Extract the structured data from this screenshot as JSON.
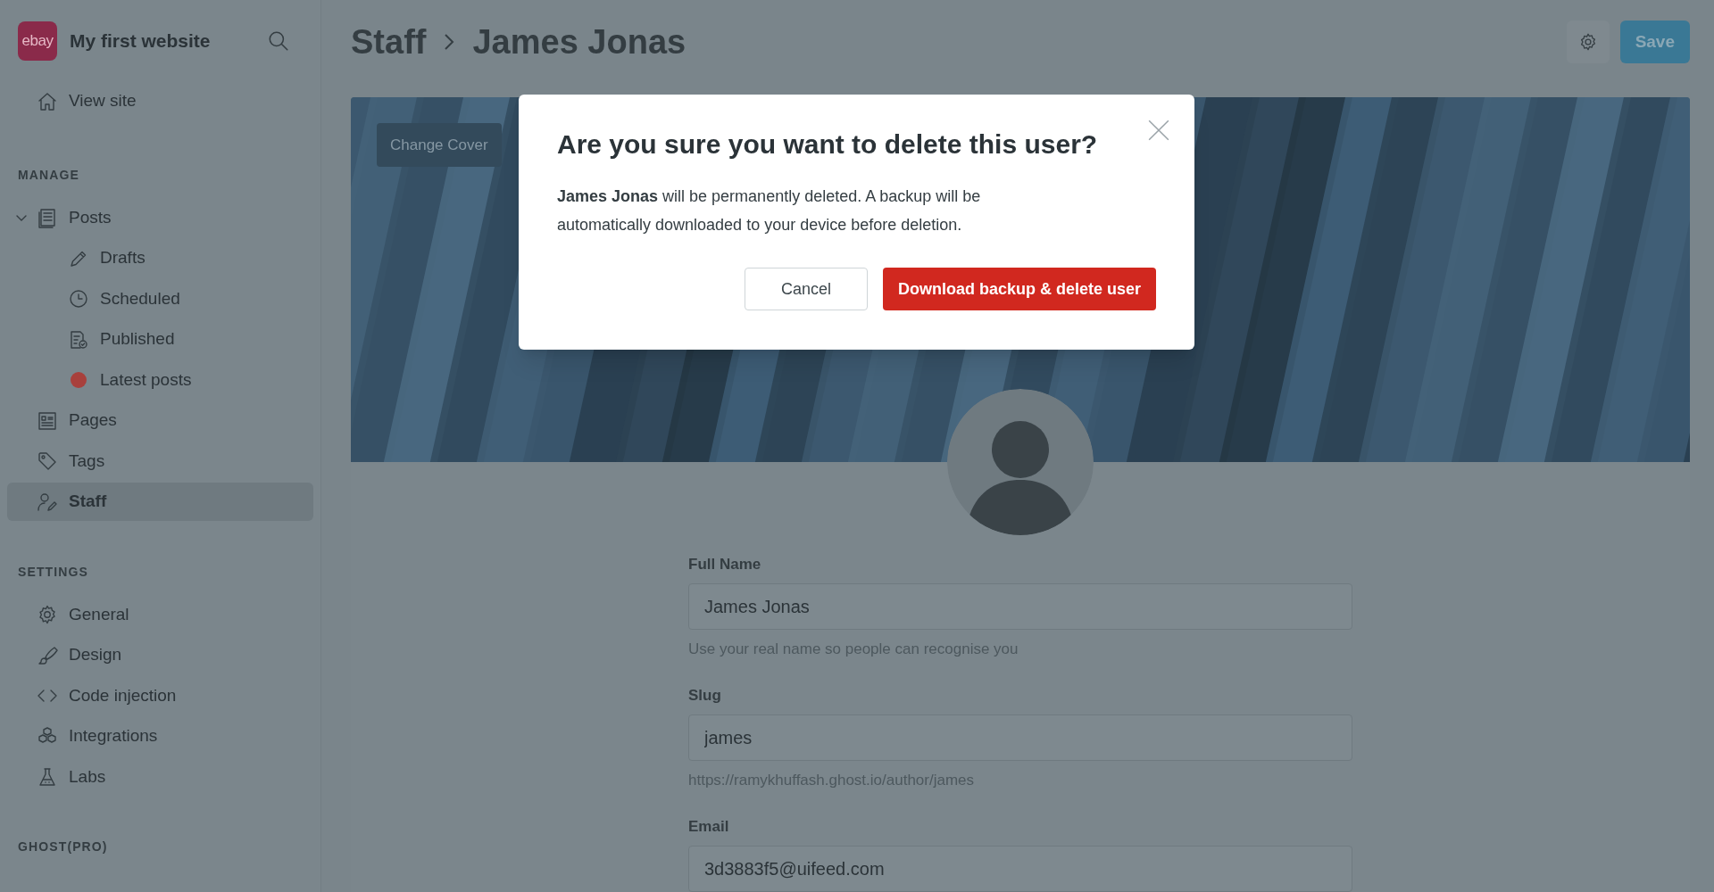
{
  "sidebar": {
    "logo_text": "ebay",
    "site_name": "My first website",
    "top_items": [
      {
        "label": "View site",
        "kind": "home",
        "selected": false
      }
    ],
    "sections": [
      {
        "heading": "MANAGE",
        "items": [
          {
            "label": "Posts",
            "kind": "posts",
            "selected": false,
            "expanded": true,
            "children": [
              {
                "label": "Drafts",
                "kind": "pencil",
                "selected": false
              },
              {
                "label": "Scheduled",
                "kind": "clock",
                "selected": false
              },
              {
                "label": "Published",
                "kind": "published",
                "selected": false
              },
              {
                "label": "Latest posts",
                "kind": "dot",
                "color": "#a8403c",
                "selected": false
              }
            ]
          },
          {
            "label": "Pages",
            "kind": "pages",
            "selected": false
          },
          {
            "label": "Tags",
            "kind": "tag",
            "selected": false
          },
          {
            "label": "Staff",
            "kind": "staff",
            "selected": true
          }
        ]
      },
      {
        "heading": "SETTINGS",
        "items": [
          {
            "label": "General",
            "kind": "gear",
            "selected": false
          },
          {
            "label": "Design",
            "kind": "brush",
            "selected": false
          },
          {
            "label": "Code injection",
            "kind": "code",
            "selected": false
          },
          {
            "label": "Integrations",
            "kind": "cubes",
            "selected": false
          },
          {
            "label": "Labs",
            "kind": "flask",
            "selected": false
          }
        ]
      },
      {
        "heading": "GHOST(PRO)"
      }
    ]
  },
  "header": {
    "breadcrumb": [
      "Staff",
      "James Jonas"
    ],
    "save_label": "Save"
  },
  "cover": {
    "change_label": "Change Cover"
  },
  "form": {
    "fields": [
      {
        "label": "Full Name",
        "value": "James Jonas",
        "hint": "Use your real name so people can recognise you"
      },
      {
        "label": "Slug",
        "value": "james",
        "hint": "https://ramykhuffash.ghost.io/author/james"
      },
      {
        "label": "Email",
        "value": "3d3883f5@uifeed.com"
      }
    ]
  },
  "dialog": {
    "title": "Are you sure you want to delete this user?",
    "body": "**James Jonas** will be permanently deleted. A backup will be automatically downloaded to your device before deletion.",
    "buttons": [
      {
        "label": "Cancel",
        "kind": "secondary"
      },
      {
        "label": "Download backup & delete user",
        "kind": "danger"
      }
    ]
  }
}
